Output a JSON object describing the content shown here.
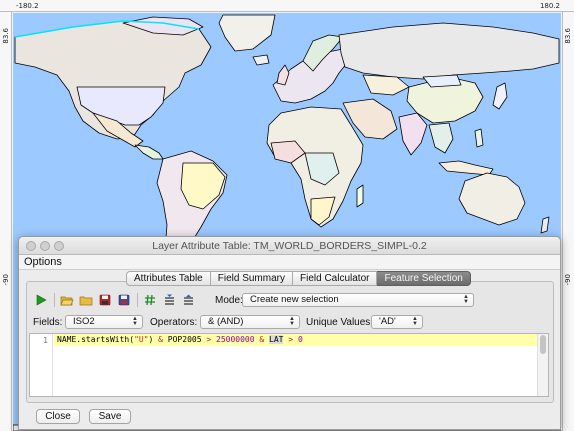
{
  "map": {
    "top_left_coord": "-180.2",
    "top_right_coord": "180.2",
    "left_top_coord": "83.6",
    "left_bottom_coord": "-90",
    "right_top_coord": "83.6",
    "right_bottom_coord": "-90",
    "ocean_color": "#9cc9ff",
    "land_color": "#f4f2ec",
    "coast_color": "#000000"
  },
  "dialog": {
    "title": "Layer Attribute Table: TM_WORLD_BORDERS_SIMPL-0.2",
    "menu": {
      "options": "Options"
    },
    "tabs": [
      {
        "label": "Attributes Table",
        "active": false
      },
      {
        "label": "Field Summary",
        "active": false
      },
      {
        "label": "Field Calculator",
        "active": false
      },
      {
        "label": "Feature Selection",
        "active": true
      }
    ],
    "toolbar": {
      "icons": [
        "play-icon",
        "open-folder-icon",
        "folder-icon",
        "save-icon",
        "save-as-icon",
        "hash-icon",
        "list-import-icon",
        "list-export-icon"
      ]
    },
    "mode": {
      "label": "Mode:",
      "value": "Create new selection"
    },
    "fields": {
      "label": "Fields:",
      "value": "ISO2"
    },
    "operators": {
      "label": "Operators:",
      "value": "& (AND)"
    },
    "unique_values": {
      "label": "Unique Values:",
      "value": "'AD'"
    },
    "editor": {
      "line_number": "1",
      "tokens": [
        {
          "text": "NAME.startsWith(",
          "cls": ""
        },
        {
          "text": "\"U\"",
          "cls": "c-str"
        },
        {
          "text": ") ",
          "cls": ""
        },
        {
          "text": "&",
          "cls": "c-op"
        },
        {
          "text": " POP2005 ",
          "cls": ""
        },
        {
          "text": ">",
          "cls": "c-op"
        },
        {
          "text": " ",
          "cls": ""
        },
        {
          "text": "25000000",
          "cls": "c-num"
        },
        {
          "text": " ",
          "cls": ""
        },
        {
          "text": "&",
          "cls": "c-op"
        },
        {
          "text": " ",
          "cls": ""
        },
        {
          "text": "LAT",
          "cls": "c-hl"
        },
        {
          "text": " ",
          "cls": ""
        },
        {
          "text": ">",
          "cls": "c-op"
        },
        {
          "text": " ",
          "cls": ""
        },
        {
          "text": "0",
          "cls": "c-num"
        }
      ]
    },
    "buttons": {
      "close": "Close",
      "save": "Save"
    }
  }
}
